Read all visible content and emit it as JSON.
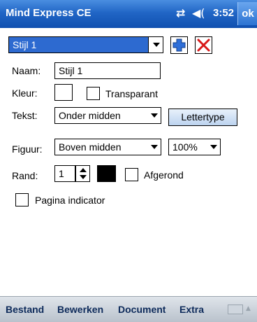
{
  "status_bar": {
    "app_title": "Mind Express CE",
    "connectivity_icon": "sync-arrows-icon",
    "volume_icon": "speaker-icon",
    "time": "3:52",
    "ok_label": "ok"
  },
  "style_select": {
    "value": "Stijl 1"
  },
  "toolbar": {
    "add_icon": "plus-icon",
    "delete_icon": "red-x-icon"
  },
  "form": {
    "naam_label": "Naam:",
    "naam_value": "Stijl 1",
    "kleur_label": "Kleur:",
    "transparant_label": "Transparant",
    "transparant_checked": false,
    "tekst_label": "Tekst:",
    "tekst_value": "Onder midden",
    "lettertype_label": "Lettertype",
    "figuur_label": "Figuur:",
    "figuur_value": "Boven midden",
    "zoom_value": "100%",
    "rand_label": "Rand:",
    "rand_value": "1",
    "rand_color": "#000000",
    "afgerond_label": "Afgerond",
    "afgerond_checked": false,
    "pagina_indicator_label": "Pagina indicator",
    "pagina_indicator_checked": false
  },
  "menu": {
    "items": [
      "Bestand",
      "Bewerken",
      "Document",
      "Extra"
    ],
    "keyboard_icon": "keyboard-icon"
  }
}
